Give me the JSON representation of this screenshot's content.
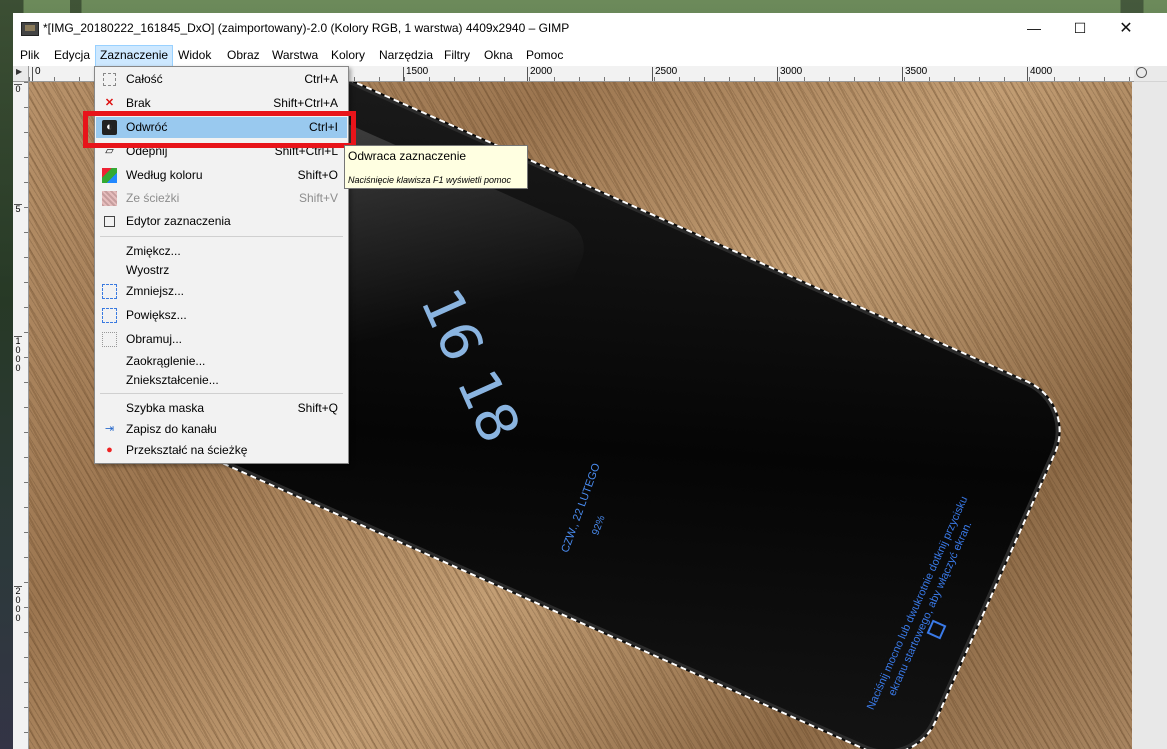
{
  "window": {
    "title": "*[IMG_20180222_161845_DxO] (zaimportowany)-2.0 (Kolory RGB, 1 warstwa) 4409x2940 – GIMP",
    "minimize": "—",
    "maximize": "☐",
    "close": "✕"
  },
  "menubar": {
    "items": [
      "Plik",
      "Edycja",
      "Zaznaczenie",
      "Widok",
      "Obraz",
      "Warstwa",
      "Kolory",
      "Narzędzia",
      "Filtry",
      "Okna",
      "Pomoc"
    ],
    "active": "Zaznaczenie"
  },
  "rulers": {
    "horizontal": [
      "0",
      "1500",
      "2000",
      "2500",
      "3000",
      "3500",
      "4000"
    ],
    "vertical": [
      "0",
      "5",
      "1000",
      "2000"
    ]
  },
  "dropdown": {
    "items": [
      {
        "label": "Całość",
        "shortcut": "Ctrl+A",
        "icon": "select-all-icon",
        "enabled": true
      },
      {
        "label": "Brak",
        "shortcut": "Shift+Ctrl+A",
        "icon": "select-none-icon",
        "enabled": true
      },
      {
        "label": "Odwróć",
        "shortcut": "Ctrl+I",
        "icon": "invert-selection-icon",
        "enabled": true,
        "highlighted": true
      },
      {
        "label": "Odepnij",
        "shortcut": "Shift+Ctrl+L",
        "icon": "float-icon",
        "enabled": true
      },
      {
        "label": "Według koloru",
        "shortcut": "Shift+O",
        "icon": "by-color-icon",
        "enabled": true
      },
      {
        "label": "Ze ścieżki",
        "shortcut": "Shift+V",
        "icon": "from-path-icon",
        "enabled": false
      },
      {
        "label": "Edytor zaznaczenia",
        "shortcut": "",
        "icon": "selection-editor-icon",
        "enabled": true
      },
      {
        "label": "Zmiękcz...",
        "shortcut": "",
        "icon": "",
        "enabled": true
      },
      {
        "label": "Wyostrz",
        "shortcut": "",
        "icon": "",
        "enabled": true
      },
      {
        "label": "Zmniejsz...",
        "shortcut": "",
        "icon": "shrink-icon",
        "enabled": true
      },
      {
        "label": "Powiększ...",
        "shortcut": "",
        "icon": "grow-icon",
        "enabled": true
      },
      {
        "label": "Obramuj...",
        "shortcut": "",
        "icon": "border-icon",
        "enabled": true
      },
      {
        "label": "Zaokrąglenie...",
        "shortcut": "",
        "icon": "",
        "enabled": true
      },
      {
        "label": "Zniekształcenie...",
        "shortcut": "",
        "icon": "",
        "enabled": true
      },
      {
        "label": "Szybka maska",
        "shortcut": "Shift+Q",
        "icon": "",
        "enabled": true
      },
      {
        "label": "Zapisz do kanału",
        "shortcut": "",
        "icon": "save-channel-icon",
        "enabled": true
      },
      {
        "label": "Przekształć na ścieżkę",
        "shortcut": "",
        "icon": "to-path-icon",
        "enabled": true
      }
    ]
  },
  "tooltip": {
    "text": "Odwraca zaznaczenie",
    "hint": "Naciśnięcie klawisza F1 wyświetli pomoc"
  },
  "phone_screen": {
    "clock": "16 18",
    "date": "CZW., 22 LUTEGO",
    "battery": "92%",
    "hint": "Naciśnij mocno lub dwukrotnie dotknij przycisku ekranu startowego, aby włączyć ekran."
  },
  "colors": {
    "highlight_box": "#e8141a",
    "menu_highlight": "#99c9ef",
    "active_menu": "#cde8ff",
    "tooltip_bg": "#ffffe1"
  }
}
